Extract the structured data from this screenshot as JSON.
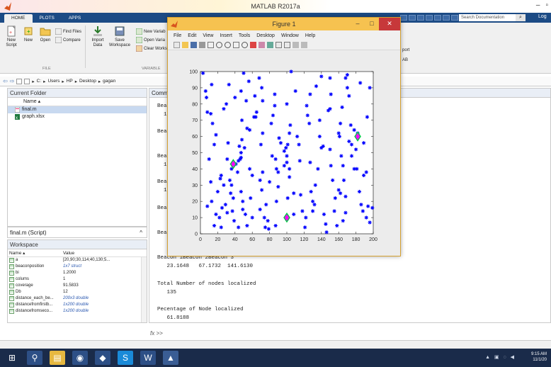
{
  "app": {
    "title": "MATLAB R2017a",
    "tabs": [
      "HOME",
      "PLOTS",
      "APPS"
    ],
    "search_placeholder": "Search Documentation",
    "log_in": "Log"
  },
  "ribbon": {
    "new_script": "New\nScript",
    "new": "New",
    "open": "Open",
    "find_files": "Find Files",
    "compare": "Compare",
    "import_data": "Import\nData",
    "save_workspace": "Save\nWorkspace",
    "new_variable": "New Variab",
    "open_variable": "Open Varia",
    "clear_workspace": "Clear Works",
    "section_file": "FILE",
    "section_variable": "VARIABLE",
    "port_label": "port",
    "ab_label": "AB"
  },
  "address": {
    "path": [
      "C:",
      "Users",
      "HP",
      "Desktop",
      "gagan"
    ]
  },
  "current_folder": {
    "title": "Current Folder",
    "col_name": "Name ▴",
    "files": [
      {
        "name": "final.m",
        "selected": true
      },
      {
        "name": "graph.xlsx",
        "selected": false
      }
    ]
  },
  "script_bar": {
    "label": "final.m  (Script)"
  },
  "workspace": {
    "title": "Workspace",
    "col_name": "Name ▴",
    "col_value": "Value",
    "rows": [
      {
        "name": "a",
        "value": "[20,90;30,114;40,130;5...",
        "blue": false
      },
      {
        "name": "beaconposition",
        "value": "1x7 struct",
        "blue": true
      },
      {
        "name": "bi",
        "value": "1.2000",
        "blue": false
      },
      {
        "name": "colums",
        "value": "1",
        "blue": false
      },
      {
        "name": "coverage",
        "value": "91.5833",
        "blue": false
      },
      {
        "name": "Db",
        "value": "12",
        "blue": false
      },
      {
        "name": "distance_each_be...",
        "value": "200x3 double",
        "blue": true
      },
      {
        "name": "distancefromfirstb...",
        "value": "1x200 double",
        "blue": true
      },
      {
        "name": "distancefromseco...",
        "value": "1x200 double",
        "blue": true
      }
    ]
  },
  "command_window": {
    "title": "Comm",
    "lines": [
      "Beac",
      "  1",
      "Beac",
      "Beac",
      "  1",
      "Beac",
      "  1",
      "Beac",
      "Beac",
      "Beacon 1Beacon 2Beacon 3",
      "   23.1648   67.1732  141.6130",
      "Total Number of nodes localized",
      "   135",
      "Pecentage of Node localized",
      "   61.8188"
    ],
    "prompt": ">>"
  },
  "figure": {
    "title": "Figure 1",
    "menu": [
      "File",
      "Edit",
      "View",
      "Insert",
      "Tools",
      "Desktop",
      "Window",
      "Help"
    ]
  },
  "taskbar": {
    "time": "9:15 AM",
    "date": "11/1/20"
  },
  "chart_data": {
    "type": "scatter",
    "title": "",
    "xlabel": "",
    "ylabel": "",
    "xlim": [
      0,
      200
    ],
    "ylim": [
      0,
      100
    ],
    "xticks": [
      0,
      20,
      40,
      60,
      80,
      100,
      120,
      140,
      160,
      180,
      200
    ],
    "yticks": [
      0,
      10,
      20,
      30,
      40,
      50,
      60,
      70,
      80,
      90,
      100
    ],
    "series": [
      {
        "marker": "asterisk",
        "color": "#0000ff",
        "points": [
          [
            3,
            99
          ],
          [
            6,
            88
          ],
          [
            8,
            75
          ],
          [
            12,
            74
          ],
          [
            13,
            92
          ],
          [
            7,
            84
          ],
          [
            14,
            68
          ],
          [
            18,
            61
          ],
          [
            16,
            55
          ],
          [
            10,
            46
          ],
          [
            12,
            32
          ],
          [
            13,
            20
          ],
          [
            8,
            17
          ],
          [
            18,
            12
          ],
          [
            22,
            10
          ],
          [
            24,
            4
          ],
          [
            16,
            5
          ],
          [
            20,
            26
          ],
          [
            23,
            34
          ],
          [
            27,
            30
          ],
          [
            24,
            36
          ],
          [
            31,
            46
          ],
          [
            27,
            77
          ],
          [
            30,
            80
          ],
          [
            32,
            56
          ],
          [
            36,
            40
          ],
          [
            34,
            33
          ],
          [
            36,
            30
          ],
          [
            35,
            25
          ],
          [
            38,
            22
          ],
          [
            29,
            18
          ],
          [
            37,
            14
          ],
          [
            41,
            43
          ],
          [
            43,
            38
          ],
          [
            44,
            45
          ],
          [
            46,
            46
          ],
          [
            47,
            47
          ],
          [
            47,
            26
          ],
          [
            49,
            20
          ],
          [
            49,
            15
          ],
          [
            52,
            12
          ],
          [
            54,
            5
          ],
          [
            47,
            50
          ],
          [
            45,
            54
          ],
          [
            48,
            58
          ],
          [
            51,
            53
          ],
          [
            48,
            70
          ],
          [
            54,
            65
          ],
          [
            53,
            82
          ],
          [
            56,
            94
          ],
          [
            57,
            64
          ],
          [
            57,
            40
          ],
          [
            60,
            10
          ],
          [
            62,
            72
          ],
          [
            64,
            72
          ],
          [
            65,
            75
          ],
          [
            63,
            85
          ],
          [
            68,
            96
          ],
          [
            72,
            82
          ],
          [
            71,
            90
          ],
          [
            72,
            62
          ],
          [
            70,
            55
          ],
          [
            72,
            38
          ],
          [
            69,
            33
          ],
          [
            71,
            27
          ],
          [
            76,
            18
          ],
          [
            74,
            10
          ],
          [
            78,
            8
          ],
          [
            79,
            3
          ],
          [
            82,
            68
          ],
          [
            84,
            73
          ],
          [
            86,
            79
          ],
          [
            86,
            86
          ],
          [
            87,
            46
          ],
          [
            88,
            40
          ],
          [
            90,
            29
          ],
          [
            90,
            38
          ],
          [
            88,
            20
          ],
          [
            91,
            59
          ],
          [
            93,
            56
          ],
          [
            97,
            42
          ],
          [
            97,
            51
          ],
          [
            99,
            53
          ],
          [
            100,
            48
          ],
          [
            100,
            44
          ],
          [
            101,
            22
          ],
          [
            103,
            35
          ],
          [
            103,
            40
          ],
          [
            101,
            55
          ],
          [
            103,
            62
          ],
          [
            104,
            67
          ],
          [
            100,
            80
          ],
          [
            105,
            100
          ],
          [
            108,
            25
          ],
          [
            110,
            88
          ],
          [
            112,
            60
          ],
          [
            114,
            55
          ],
          [
            115,
            45
          ],
          [
            116,
            24
          ],
          [
            118,
            14
          ],
          [
            122,
            10
          ],
          [
            121,
            4
          ],
          [
            124,
            73
          ],
          [
            126,
            68
          ],
          [
            123,
            79
          ],
          [
            127,
            86
          ],
          [
            127,
            44
          ],
          [
            128,
            26
          ],
          [
            130,
            20
          ],
          [
            132,
            18
          ],
          [
            133,
            30
          ],
          [
            136,
            40
          ],
          [
            138,
            60
          ],
          [
            138,
            70
          ],
          [
            140,
            53
          ],
          [
            142,
            54
          ],
          [
            143,
            12
          ],
          [
            145,
            6
          ],
          [
            146,
            1
          ],
          [
            148,
            76
          ],
          [
            150,
            77
          ],
          [
            151,
            86
          ],
          [
            150,
            52
          ],
          [
            151,
            42
          ],
          [
            153,
            33
          ],
          [
            155,
            14
          ],
          [
            156,
            22
          ],
          [
            158,
            5
          ],
          [
            160,
            27
          ],
          [
            162,
            25
          ],
          [
            163,
            48
          ],
          [
            165,
            42
          ],
          [
            166,
            33
          ],
          [
            168,
            23
          ],
          [
            168,
            13
          ],
          [
            165,
            8
          ],
          [
            160,
            62
          ],
          [
            162,
            68
          ],
          [
            164,
            78
          ],
          [
            168,
            96
          ],
          [
            170,
            98
          ],
          [
            170,
            90
          ],
          [
            172,
            57
          ],
          [
            175,
            55
          ],
          [
            178,
            64
          ],
          [
            180,
            52
          ],
          [
            182,
            62
          ],
          [
            181,
            40
          ],
          [
            184,
            26
          ],
          [
            186,
            18
          ],
          [
            188,
            14
          ],
          [
            189,
            36
          ],
          [
            192,
            38
          ],
          [
            193,
            72
          ],
          [
            192,
            10
          ],
          [
            196,
            7
          ],
          [
            194,
            17
          ],
          [
            199,
            16
          ],
          [
            189,
            56
          ],
          [
            196,
            90
          ],
          [
            185,
            93
          ],
          [
            175,
            48
          ],
          [
            178,
            40
          ],
          [
            174,
            67
          ],
          [
            172,
            85
          ],
          [
            161,
            60
          ],
          [
            150,
            96
          ],
          [
            140,
            97
          ],
          [
            134,
            91
          ],
          [
            130,
            14
          ],
          [
            108,
            12
          ],
          [
            87,
            5
          ],
          [
            83,
            48
          ],
          [
            80,
            32
          ],
          [
            75,
            4
          ],
          [
            69,
            15
          ],
          [
            60,
            36
          ],
          [
            58,
            22
          ],
          [
            44,
            4
          ],
          [
            39,
            8
          ],
          [
            31,
            13
          ],
          [
            25,
            16
          ],
          [
            33,
            92
          ],
          [
            40,
            84
          ],
          [
            47,
            88
          ],
          [
            50,
            99
          ]
        ]
      },
      {
        "marker": "diamond",
        "color": "#ff00ff",
        "edge": "#00cc44",
        "points": [
          [
            38,
            43
          ],
          [
            100,
            10
          ],
          [
            182,
            60
          ]
        ]
      }
    ]
  }
}
